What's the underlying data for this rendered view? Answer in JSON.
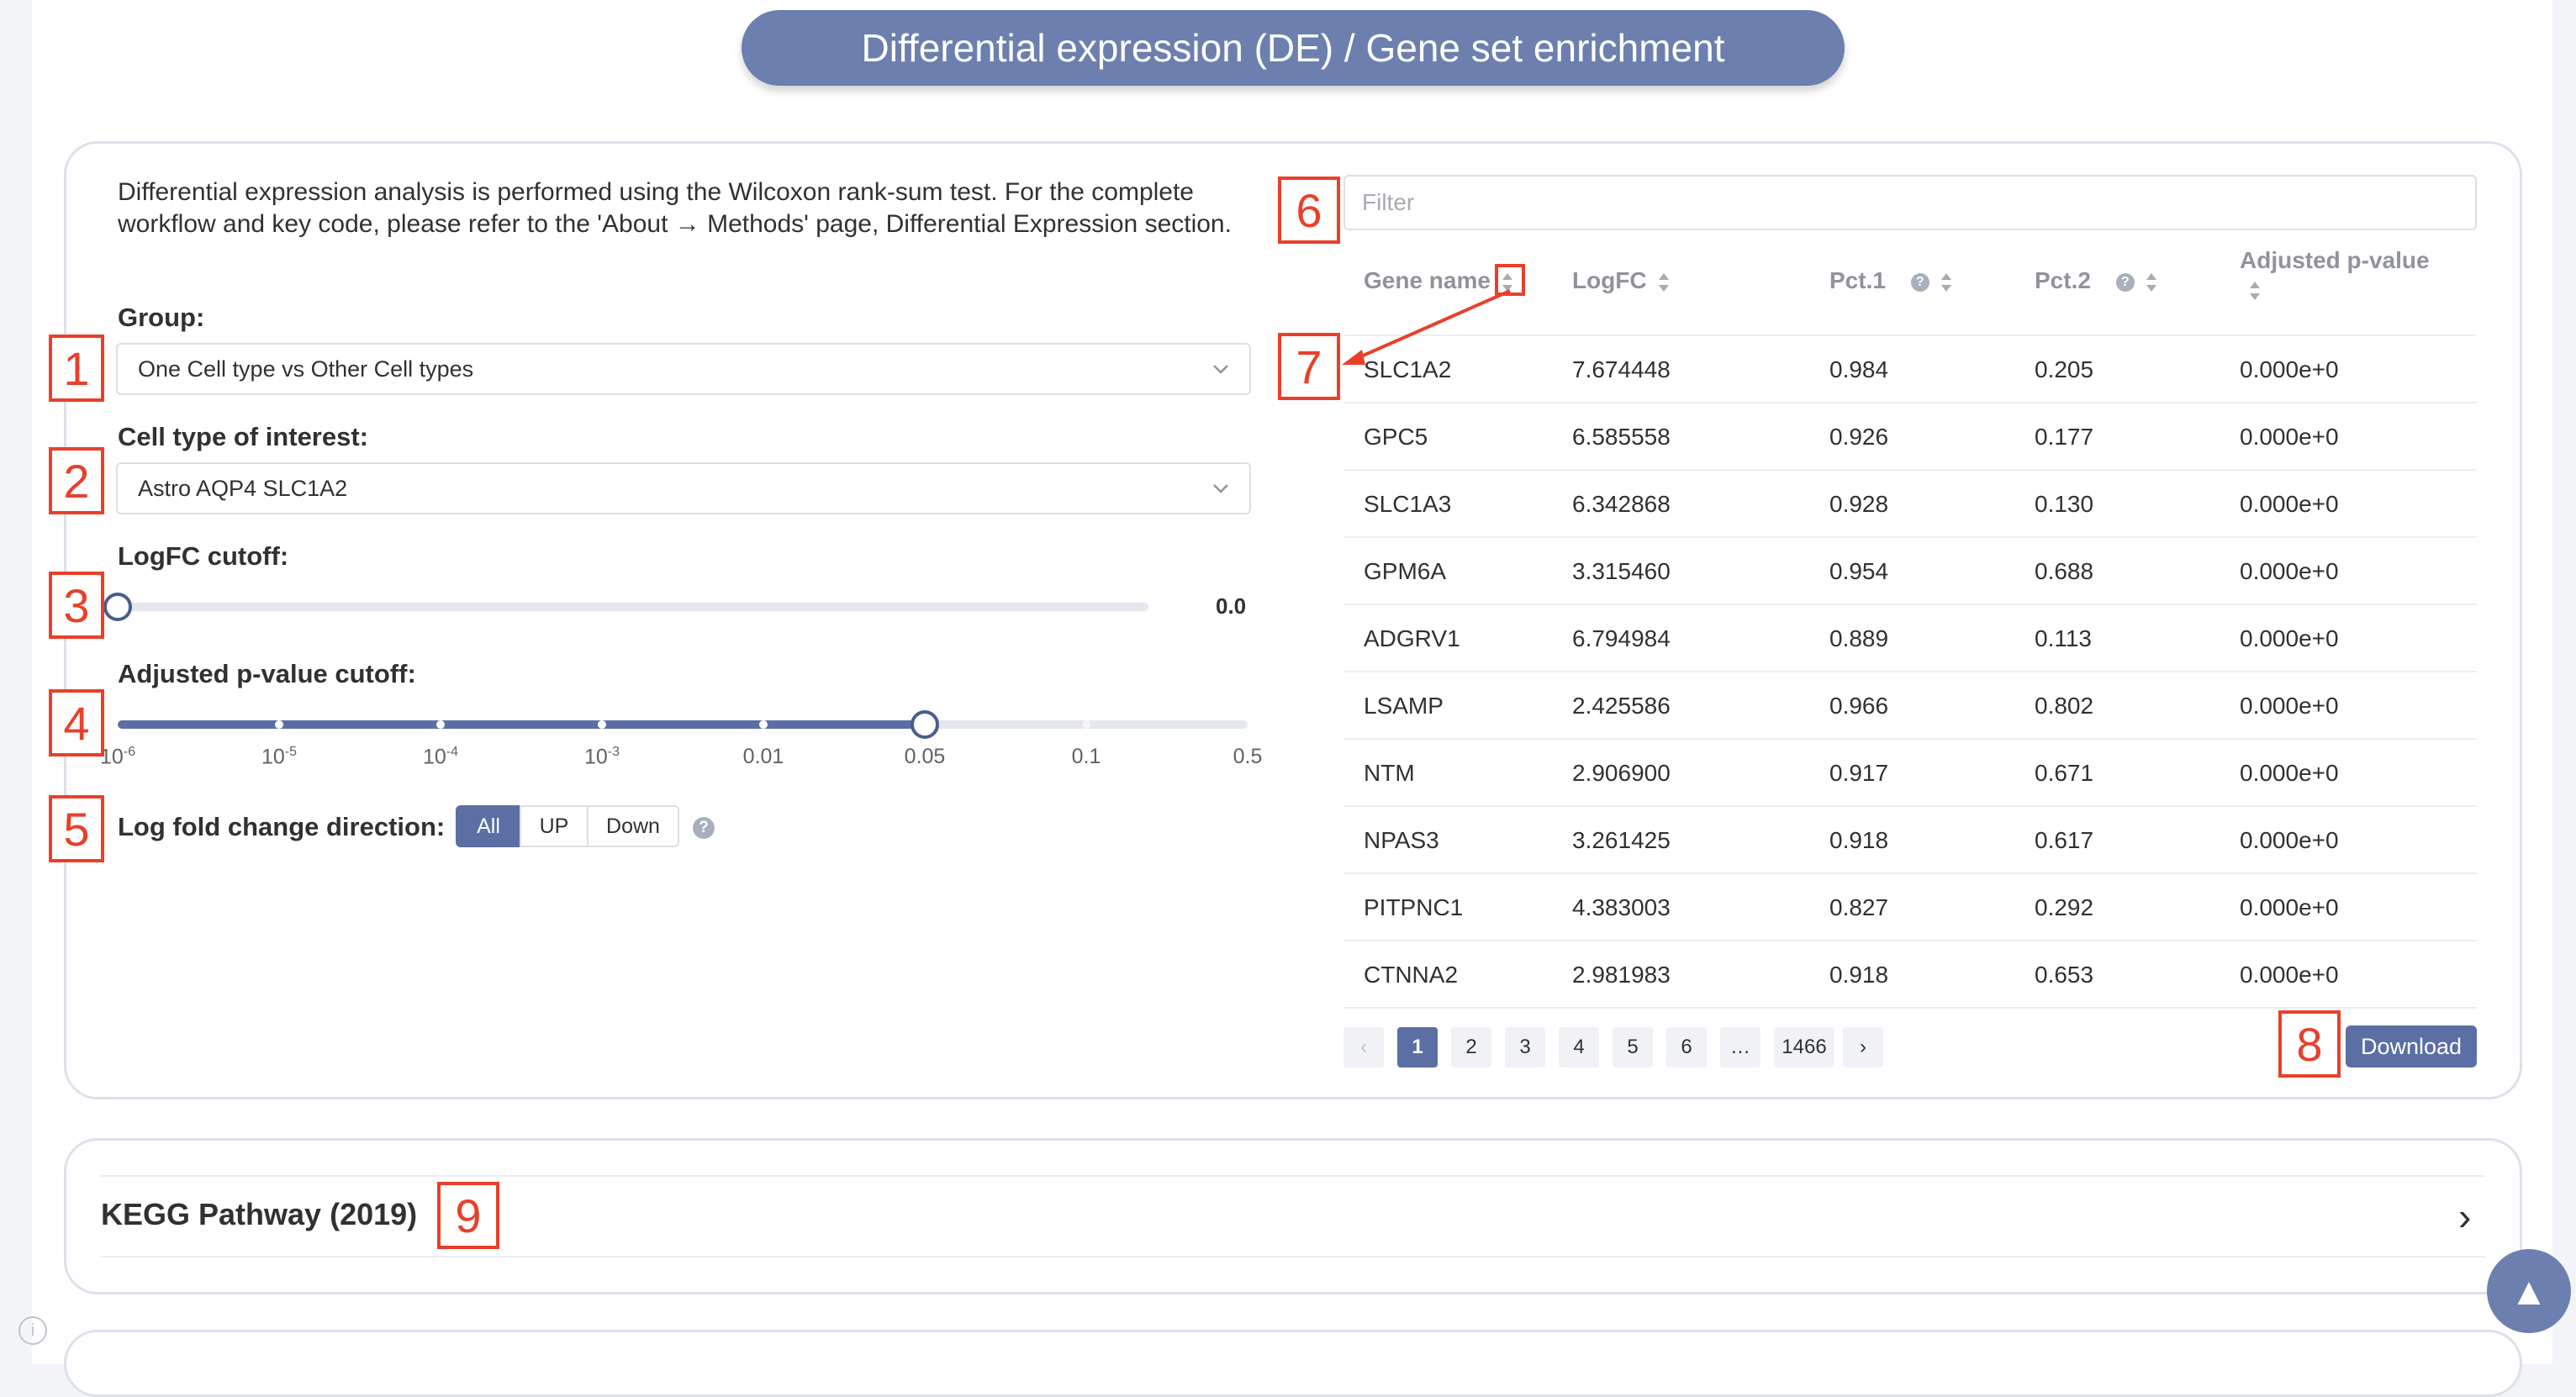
{
  "header": {
    "title": "Differential expression (DE) / Gene set enrichment"
  },
  "left": {
    "description": "Differential expression analysis is performed using the Wilcoxon rank-sum test. For the complete workflow and key code, please refer to the 'About → Methods' page, Differential Expression section.",
    "group_label": "Group:",
    "group_value": "One Cell type vs Other Cell types",
    "celltype_label": "Cell type of interest:",
    "celltype_value": "Astro AQP4 SLC1A2",
    "logfc_label": "LogFC cutoff:",
    "logfc_value": "0.0",
    "logfc_level": 0.0,
    "pval_label": "Adjusted p-value cutoff:",
    "pval_ticks": [
      {
        "base": "10",
        "exp": "-6"
      },
      {
        "base": "10",
        "exp": "-5"
      },
      {
        "base": "10",
        "exp": "-4"
      },
      {
        "base": "10",
        "exp": "-3"
      },
      {
        "base": "0.01",
        "exp": ""
      },
      {
        "base": "0.05",
        "exp": ""
      },
      {
        "base": "0.1",
        "exp": ""
      },
      {
        "base": "0.5",
        "exp": ""
      }
    ],
    "pval_selected_index": 5,
    "direction_label": "Log fold change direction:",
    "direction_options": [
      "All",
      "UP",
      "Down"
    ],
    "direction_selected": "All",
    "help_glyph": "?"
  },
  "markers": [
    "1",
    "2",
    "3",
    "4",
    "5",
    "6",
    "7",
    "8",
    "9"
  ],
  "table": {
    "filter_placeholder": "Filter",
    "headers": {
      "gene": "Gene name",
      "logfc": "LogFC",
      "pct1": "Pct.1",
      "pct2": "Pct.2",
      "padj_line1": "Adjusted p-value"
    },
    "rows": [
      {
        "gene": "SLC1A2",
        "logfc": "7.674448",
        "pct1": "0.984",
        "pct2": "0.205",
        "padj": "0.000e+0"
      },
      {
        "gene": "GPC5",
        "logfc": "6.585558",
        "pct1": "0.926",
        "pct2": "0.177",
        "padj": "0.000e+0"
      },
      {
        "gene": "SLC1A3",
        "logfc": "6.342868",
        "pct1": "0.928",
        "pct2": "0.130",
        "padj": "0.000e+0"
      },
      {
        "gene": "GPM6A",
        "logfc": "3.315460",
        "pct1": "0.954",
        "pct2": "0.688",
        "padj": "0.000e+0"
      },
      {
        "gene": "ADGRV1",
        "logfc": "6.794984",
        "pct1": "0.889",
        "pct2": "0.113",
        "padj": "0.000e+0"
      },
      {
        "gene": "LSAMP",
        "logfc": "2.425586",
        "pct1": "0.966",
        "pct2": "0.802",
        "padj": "0.000e+0"
      },
      {
        "gene": "NTM",
        "logfc": "2.906900",
        "pct1": "0.917",
        "pct2": "0.671",
        "padj": "0.000e+0"
      },
      {
        "gene": "NPAS3",
        "logfc": "3.261425",
        "pct1": "0.918",
        "pct2": "0.617",
        "padj": "0.000e+0"
      },
      {
        "gene": "PITPNC1",
        "logfc": "4.383003",
        "pct1": "0.827",
        "pct2": "0.292",
        "padj": "0.000e+0"
      },
      {
        "gene": "CTNNA2",
        "logfc": "2.981983",
        "pct1": "0.918",
        "pct2": "0.653",
        "padj": "0.000e+0"
      }
    ],
    "pagination": {
      "pages": [
        "1",
        "2",
        "3",
        "4",
        "5",
        "6",
        "…",
        "1466"
      ],
      "current": "1",
      "prev": "‹",
      "next": "›"
    },
    "download_label": "Download"
  },
  "kegg": {
    "title": "KEGG Pathway (2019)",
    "chevron": "›"
  },
  "scroll_top_glyph": "▲",
  "info_glyph": "i",
  "colors": {
    "accent": "#5b6fa5",
    "title_pill": "#6c7fae",
    "marker": "#e8402a"
  }
}
